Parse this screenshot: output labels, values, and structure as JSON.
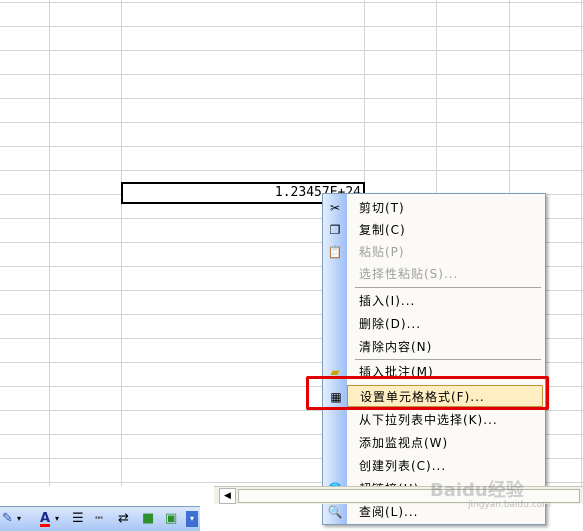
{
  "cell": {
    "value": "1.23457E+24"
  },
  "menu": {
    "items": [
      {
        "label": "剪切(T)",
        "icon": "scissors-icon",
        "enabled": true
      },
      {
        "label": "复制(C)",
        "icon": "copy-icon",
        "enabled": true
      },
      {
        "label": "粘贴(P)",
        "icon": "paste-icon",
        "enabled": false
      },
      {
        "label": "选择性粘贴(S)...",
        "icon": "",
        "enabled": false
      },
      {
        "label": "插入(I)...",
        "icon": "",
        "enabled": true
      },
      {
        "label": "删除(D)...",
        "icon": "",
        "enabled": true
      },
      {
        "label": "清除内容(N)",
        "icon": "",
        "enabled": true
      },
      {
        "label": "插入批注(M)",
        "icon": "comment-icon",
        "enabled": true
      },
      {
        "label": "设置单元格格式(F)...",
        "icon": "format-cells-icon",
        "enabled": true,
        "highlighted": true
      },
      {
        "label": "从下拉列表中选择(K)...",
        "icon": "",
        "enabled": true
      },
      {
        "label": "添加监视点(W)",
        "icon": "",
        "enabled": true
      },
      {
        "label": "创建列表(C)...",
        "icon": "",
        "enabled": true
      },
      {
        "label": "超链接(H)...",
        "icon": "hyperlink-icon",
        "enabled": true
      },
      {
        "label": "查阅(L)...",
        "icon": "research-icon",
        "enabled": true
      }
    ]
  },
  "watermark": {
    "main": "Baidu经验",
    "sub": "jingyan.baidu.com"
  },
  "colors": {
    "highlight_box": "#e00000",
    "menu_hover": "#ffeec2",
    "font_color_bar": "#ff0000"
  }
}
